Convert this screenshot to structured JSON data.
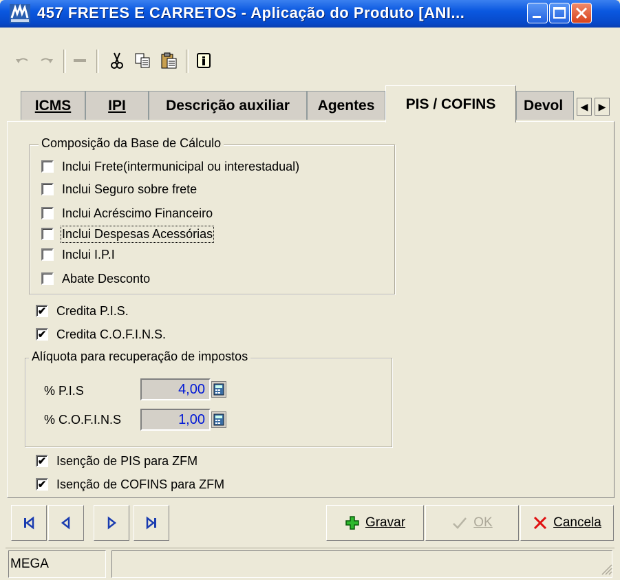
{
  "window": {
    "title": "457 FRETES E CARRETOS - Aplicação do Produto [ANI...",
    "app_icon": "mega-logo-icon",
    "controls": [
      "minimize",
      "maximize",
      "close"
    ]
  },
  "toolbar": {
    "items": [
      "undo-icon",
      "redo-icon",
      "delete-icon",
      "cut-icon",
      "copy-icon",
      "paste-icon",
      "info-icon"
    ]
  },
  "tabs": [
    {
      "label": "ICMS"
    },
    {
      "label": "IPI"
    },
    {
      "label": "Descrição auxiliar"
    },
    {
      "label": "Agentes"
    },
    {
      "label": "PIS / COFINS",
      "active": true
    },
    {
      "label": "Devol"
    }
  ],
  "base_calculo": {
    "legend": "Composição da Base de Cálculo",
    "items": [
      {
        "label": "Inclui Frete(intermunicipal ou interestadual)",
        "checked": false
      },
      {
        "label": "Inclui Seguro sobre frete",
        "checked": false
      },
      {
        "label": "Inclui Acréscimo Financeiro",
        "checked": false
      },
      {
        "label": "Inclui Despesas Acessórias",
        "checked": false
      },
      {
        "label": "Inclui I.P.I",
        "checked": false
      },
      {
        "label": "Abate Desconto",
        "checked": false
      }
    ]
  },
  "credita": [
    {
      "label": "Credita P.I.S.",
      "checked": true
    },
    {
      "label": "Credita C.O.F.I.N.S.",
      "checked": true
    }
  ],
  "aliquota": {
    "legend": "Alíquota para recuperação de impostos",
    "pis_label": "% P.I.S",
    "pis_value": "4,00",
    "cofins_label": "% C.O.F.I.N.S",
    "cofins_value": "1,00"
  },
  "isencao": [
    {
      "label": "Isenção de PIS para ZFM",
      "checked": true
    },
    {
      "label": "Isenção de COFINS para ZFM",
      "checked": true
    }
  ],
  "buttons": {
    "gravar": "Gravar",
    "ok": "OK",
    "cancela": "Cancela"
  },
  "status": {
    "panel1": "MEGA",
    "panel2": ""
  }
}
